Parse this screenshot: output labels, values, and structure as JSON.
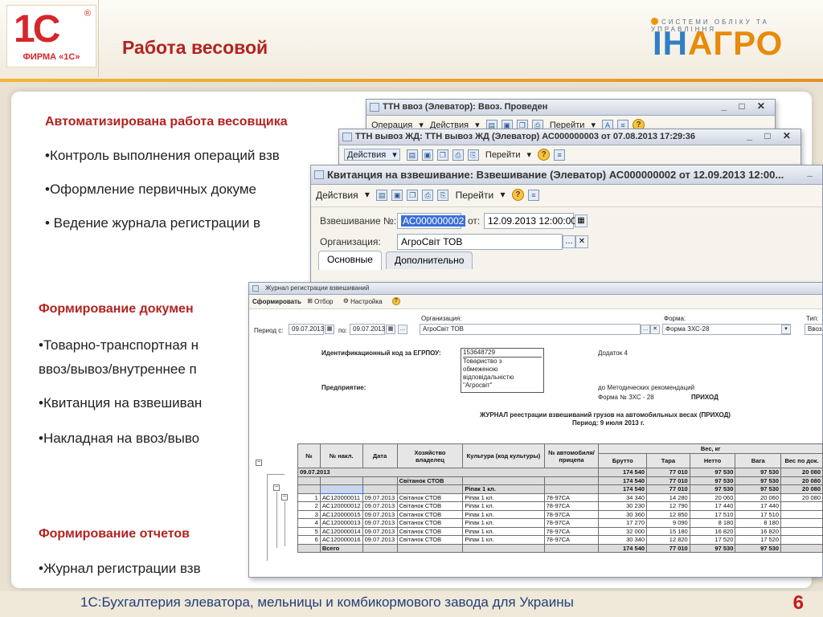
{
  "header": {
    "logo_text": "1С",
    "logo_reg": "®",
    "logo_firm": "ФИРМА «1С»",
    "title": "Работа весовой",
    "agro_tagline": "СИСТЕМИ ОБЛІКУ ТА УПРАВЛІННЯ",
    "agro_name_a": "ІН",
    "agro_name_b": "АГРО"
  },
  "content": {
    "h1": "Автоматизирована работа весовщика",
    "b1": "•Контроль выполнения операций взв",
    "b2": "•Оформление первичных докуме",
    "b3": "• Ведение журнала регистрации в",
    "h2": "Формирование докумен",
    "b4": "•Товарно-транспортная н",
    "b4b": "ввоз/вывоз/внутреннее п",
    "b5": "•Квитанция на взвешиван",
    "b6": "•Накладная на ввоз/выво",
    "h3": "Формирование отчетов",
    "b7": "•Журнал регистрации взв"
  },
  "win1": {
    "title": "ТТН ввоз (Элеватор): Ввоз. Проведен",
    "operation": "Операция",
    "actions": "Действия",
    "goto": "Перейти"
  },
  "win2": {
    "title": "ТТН вывоз ЖД: ТТН вывоз ЖД (Элеватор) АС000000003 от 07.08.2013 17:29:36",
    "actions": "Действия",
    "goto": "Перейти"
  },
  "win3": {
    "title": "Квитанция на взвешивание: Взвешивание (Элеватор) АС000000002 от 12.09.2013 12:00...",
    "actions": "Действия",
    "goto": "Перейти",
    "label_num": "Взвешивание №:",
    "num": "АС000000002",
    "label_from": "от:",
    "date": "12.09.2013 12:00:00",
    "label_org": "Организация:",
    "org": "АгроСвіт ТОВ",
    "tab_main": "Основные",
    "tab_extra": "Дополнительно"
  },
  "journal": {
    "title": "Журнал регистрации взвешиваний",
    "btn_form": "Сформировать",
    "btn_filter": "Отбор",
    "btn_setup": "Настройка",
    "lbl_period": "Период с:",
    "date_from": "09.07.2013",
    "lbl_to": "по:",
    "date_to": "09.07.2013",
    "lbl_org": "Организация:",
    "org": "АгроСвіт ТОВ",
    "lbl_form": "Форма:",
    "form": "Форма ЗХС-28",
    "lbl_type": "Тип:",
    "type": "Ввоз",
    "id_label": "Идентификационный код за ЕГРПОУ:",
    "id_code": "153648729",
    "ent_name_1": "Товариство з",
    "ent_name_2": "обмеженою",
    "ent_name_3": "відповідальністю",
    "ent_name_4": "\"Агросвіт\"",
    "dodatok": "Додаток 4",
    "ent_label": "Предприятие:",
    "method": "до Методических рекомендаций",
    "form_no": "Форма № ЗХС - 28",
    "prikhod": "ПРИХОД",
    "rep_title": "ЖУРНАЛ реестрации взвешиваний грузов на автомобильных весах (ПРИХОД)",
    "rep_period": "Период: 9 июля 2013 г.",
    "cols": {
      "no": "№",
      "nakl": "№ накл.",
      "date": "Дата",
      "farm": "Хозяйство владелец",
      "crop": "Культура (код культуры)",
      "auto": "№ автомобиля/ прицепа",
      "weight": "Вес, кг",
      "brutto": "Брутто",
      "tara": "Тара",
      "netto": "Нетто",
      "vaga": "Вага",
      "doc": "Вес по док."
    },
    "grp_date": {
      "label": "09.07.2013",
      "brutto": "174 540",
      "tara": "77 010",
      "netto": "97 530",
      "vaga": "97 530",
      "doc": "20 080"
    },
    "grp_farm": {
      "label": "Світанок СТОВ",
      "brutto": "174 540",
      "tara": "77 010",
      "netto": "97 530",
      "vaga": "97 530",
      "doc": "20 080"
    },
    "grp_crop": {
      "label": "Рiпак 1 кл.",
      "brutto": "174 540",
      "tara": "77 010",
      "netto": "97 530",
      "vaga": "97 530",
      "doc": "20 080"
    },
    "rows": [
      {
        "no": "1",
        "nakl": "АС120000011",
        "date": "09.07.2013",
        "farm": "Світанок СТОВ",
        "crop": "Рiпак 1 кл.",
        "auto": "78-97СА",
        "brutto": "34 340",
        "tara": "14 280",
        "netto": "20 060",
        "vaga": "20 060",
        "doc": "20 080"
      },
      {
        "no": "2",
        "nakl": "АС120000012",
        "date": "09.07.2013",
        "farm": "Світанок СТОВ",
        "crop": "Рiпак 1 кл.",
        "auto": "78-97СА",
        "brutto": "30 230",
        "tara": "12 790",
        "netto": "17 440",
        "vaga": "17 440",
        "doc": ""
      },
      {
        "no": "3",
        "nakl": "АС120000015",
        "date": "09.07.2013",
        "farm": "Світанок СТОВ",
        "crop": "Рiпак 1 кл.",
        "auto": "78-97СА",
        "brutto": "30 360",
        "tara": "12 850",
        "netto": "17 510",
        "vaga": "17 510",
        "doc": ""
      },
      {
        "no": "4",
        "nakl": "АС120000013",
        "date": "09.07.2013",
        "farm": "Світанок СТОВ",
        "crop": "Рiпак 1 кл.",
        "auto": "78-97СА",
        "brutto": "17 270",
        "tara": "9 090",
        "netto": "8 180",
        "vaga": "8 180",
        "doc": ""
      },
      {
        "no": "5",
        "nakl": "АС120000014",
        "date": "09.07.2013",
        "farm": "Світанок СТОВ",
        "crop": "Рiпак 1 кл.",
        "auto": "78-97СА",
        "brutto": "32 000",
        "tara": "15 180",
        "netto": "16 820",
        "vaga": "16 820",
        "doc": ""
      },
      {
        "no": "6",
        "nakl": "АС120000016",
        "date": "09.07.2013",
        "farm": "Світанок СТОВ",
        "crop": "Рiпак 1 кл.",
        "auto": "78-97СА",
        "brutto": "30 340",
        "tara": "12 820",
        "netto": "17 520",
        "vaga": "17 520",
        "doc": ""
      }
    ],
    "total": {
      "label": "Всего",
      "brutto": "174 540",
      "tara": "77 010",
      "netto": "97 530",
      "vaga": "97 530"
    }
  },
  "footer": {
    "text": "1С:Бухгалтерия элеватора, мельницы и комбикормового завода для Украины",
    "page": "6"
  }
}
